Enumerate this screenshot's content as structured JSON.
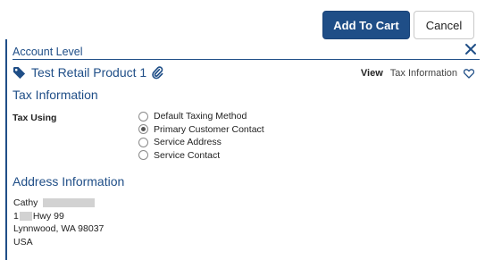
{
  "toolbar": {
    "add_to_cart_label": "Add To Cart",
    "cancel_label": "Cancel"
  },
  "panel": {
    "header": "Account Level",
    "product": {
      "name": "Test Retail Product 1"
    },
    "view": {
      "label": "View",
      "value": "Tax Information"
    },
    "tax_section": {
      "title": "Tax Information",
      "field_label": "Tax Using",
      "options": [
        {
          "label": "Default Taxing Method",
          "checked": false
        },
        {
          "label": "Primary Customer Contact",
          "checked": true
        },
        {
          "label": "Service Address",
          "checked": false
        },
        {
          "label": "Service Contact",
          "checked": false
        }
      ]
    },
    "address_section": {
      "title": "Address Information",
      "first_name": "Cathy",
      "street_prefix": "1",
      "street_suffix": "Hwy 99",
      "city_line": "Lynnwood, WA 98037",
      "country": "USA"
    }
  },
  "colors": {
    "brand": "#1f4e87",
    "text": "#222222",
    "redaction": "#d2d2d2"
  },
  "icons": [
    "tag-icon",
    "paperclip-icon",
    "close-icon",
    "heart-icon"
  ]
}
